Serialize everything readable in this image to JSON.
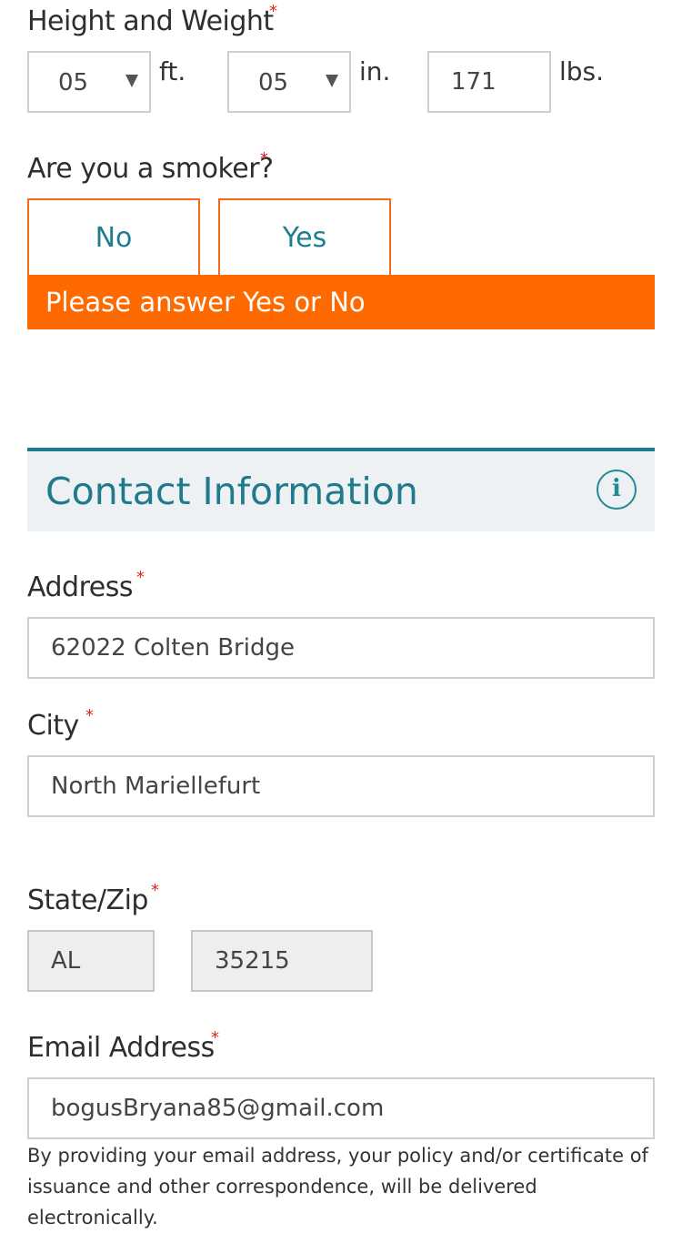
{
  "height_weight": {
    "label": "Height and Weight",
    "required_mark": "*",
    "feet_value": "05",
    "feet_unit": "ft.",
    "inches_value": "05",
    "inches_unit": "in.",
    "weight_value": "171",
    "weight_unit": "lbs."
  },
  "smoker": {
    "label": "Are you a smoker?",
    "required_mark": "*",
    "no_label": "No",
    "yes_label": "Yes",
    "error_message": "Please answer Yes or No"
  },
  "contact_section": {
    "title": "Contact Information",
    "info_icon_glyph": "i"
  },
  "address": {
    "label": "Address",
    "required_mark": "*",
    "value": "62022 Colten Bridge"
  },
  "city": {
    "label": "City",
    "required_mark": "*",
    "value": "North Mariellefurt"
  },
  "state_zip": {
    "label": "State/Zip",
    "required_mark": "*",
    "state_value": "AL",
    "zip_value": "35215"
  },
  "email": {
    "label": "Email Address",
    "required_mark": "*",
    "value": "bogusBryana85@gmail.com",
    "disclaimer": "By providing your email address, your policy and/or certificate of issuance and other correspondence, will be delivered electronically."
  },
  "colors": {
    "accent_orange": "#ff6a00",
    "teal": "#1f7a8c",
    "required_red": "#e0261b"
  },
  "icons": {
    "dropdown": "chevron-down-icon",
    "info": "info-icon"
  }
}
